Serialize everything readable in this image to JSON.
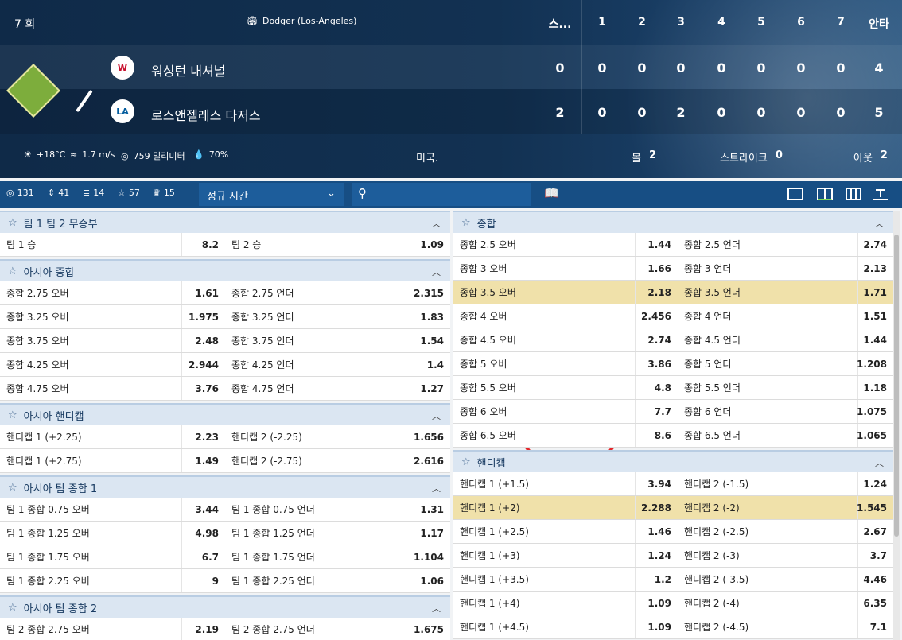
{
  "scoreboard": {
    "inning": "7 회",
    "stadium": "Dodger (Los-Angeles)",
    "col_score": "스...",
    "innings": [
      "1",
      "2",
      "3",
      "4",
      "5",
      "6",
      "7"
    ],
    "col_hits": "안타",
    "team1": {
      "name": "워싱턴 내셔널",
      "score": "0",
      "innings": [
        "0",
        "0",
        "0",
        "0",
        "0",
        "0",
        "0"
      ],
      "hits": "4"
    },
    "team2": {
      "name": "로스앤젤레스 다저스",
      "score": "2",
      "innings": [
        "0",
        "0",
        "2",
        "0",
        "0",
        "0",
        "0"
      ],
      "hits": "5"
    },
    "weather": {
      "temp": "+18°C",
      "wind": "1.7 m/s",
      "pressure": "759 밀리미터",
      "humidity": "70%"
    },
    "country": "미국.",
    "ball_label": "볼",
    "ball": "2",
    "strike_label": "스트라이크",
    "strike": "0",
    "out_label": "아웃",
    "out": "2"
  },
  "toolbar": {
    "stats": [
      "131",
      "41",
      "14",
      "57",
      "15"
    ],
    "period": "정규 시간"
  },
  "left_panels": [
    {
      "title": "팀 1 팀 2 무승부",
      "rows": [
        [
          "팀 1 승",
          "8.2",
          "팀 2 승",
          "1.09"
        ]
      ]
    },
    {
      "title": "아시아 종합",
      "rows": [
        [
          "종합 2.75 오버",
          "1.61",
          "종합 2.75 언더",
          "2.315"
        ],
        [
          "종합 3.25 오버",
          "1.975",
          "종합 3.25 언더",
          "1.83"
        ],
        [
          "종합 3.75 오버",
          "2.48",
          "종합 3.75 언더",
          "1.54"
        ],
        [
          "종합 4.25 오버",
          "2.944",
          "종합 4.25 언더",
          "1.4"
        ],
        [
          "종합 4.75 오버",
          "3.76",
          "종합 4.75 언더",
          "1.27"
        ]
      ]
    },
    {
      "title": "아시아 핸디캡",
      "rows": [
        [
          "핸디캡 1 (+2.25)",
          "2.23",
          "핸디캡 2 (-2.25)",
          "1.656"
        ],
        [
          "핸디캡 1 (+2.75)",
          "1.49",
          "핸디캡 2 (-2.75)",
          "2.616"
        ]
      ]
    },
    {
      "title": "아시아 팀 종합 1",
      "rows": [
        [
          "팀 1 종합 0.75 오버",
          "3.44",
          "팀 1 종합 0.75 언더",
          "1.31"
        ],
        [
          "팀 1 종합 1.25 오버",
          "4.98",
          "팀 1 종합 1.25 언더",
          "1.17"
        ],
        [
          "팀 1 종합 1.75 오버",
          "6.7",
          "팀 1 종합 1.75 언더",
          "1.104"
        ],
        [
          "팀 1 종합 2.25 오버",
          "9",
          "팀 1 종합 2.25 언더",
          "1.06"
        ]
      ]
    },
    {
      "title": "아시아 팀 종합 2",
      "rows": [
        [
          "팀 2 종합 2.75 오버",
          "2.19",
          "팀 2 종합 2.75 언더",
          "1.675"
        ]
      ]
    }
  ],
  "right_panels": [
    {
      "title": "종합",
      "rows": [
        [
          "종합 2.5 오버",
          "1.44",
          "종합 2.5 언더",
          "2.74"
        ],
        [
          "종합 3 오버",
          "1.66",
          "종합 3 언더",
          "2.13"
        ],
        [
          "종합 3.5 오버",
          "2.18",
          "종합 3.5 언더",
          "1.71"
        ],
        [
          "종합 4 오버",
          "2.456",
          "종합 4 언더",
          "1.51"
        ],
        [
          "종합 4.5 오버",
          "2.74",
          "종합 4.5 언더",
          "1.44"
        ],
        [
          "종합 5 오버",
          "3.86",
          "종합 5 언더",
          "1.208"
        ],
        [
          "종합 5.5 오버",
          "4.8",
          "종합 5.5 언더",
          "1.18"
        ],
        [
          "종합 6 오버",
          "7.7",
          "종합 6 언더",
          "1.075"
        ],
        [
          "종합 6.5 오버",
          "8.6",
          "종합 6.5 언더",
          "1.065"
        ]
      ]
    },
    {
      "title": "핸디캡",
      "rows": [
        [
          "핸디캡 1 (+1.5)",
          "3.94",
          "핸디캡 2 (-1.5)",
          "1.24"
        ],
        [
          "핸디캡 1 (+2)",
          "2.288",
          "핸디캡 2 (-2)",
          "1.545"
        ],
        [
          "핸디캡 1 (+2.5)",
          "1.46",
          "핸디캡 2 (-2.5)",
          "2.67"
        ],
        [
          "핸디캡 1 (+3)",
          "1.24",
          "핸디캡 2 (-3)",
          "3.7"
        ],
        [
          "핸디캡 1 (+3.5)",
          "1.2",
          "핸디캡 2 (-3.5)",
          "4.46"
        ],
        [
          "핸디캡 1 (+4)",
          "1.09",
          "핸디캡 2 (-4)",
          "6.35"
        ],
        [
          "핸디캡 1 (+4.5)",
          "1.09",
          "핸디캡 2 (-4.5)",
          "7.1"
        ]
      ]
    }
  ],
  "highlight": {
    "color": "#f0e1aa",
    "annotation": "#e3262a"
  }
}
